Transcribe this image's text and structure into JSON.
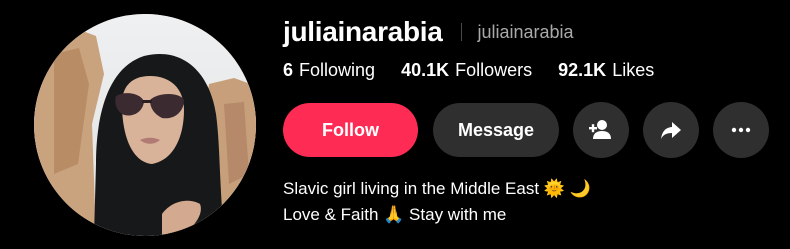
{
  "profile": {
    "username": "juliainarabia",
    "nickname": "juliainarabia",
    "stats": {
      "following_count": "6",
      "following_label": "Following",
      "followers_count": "40.1K",
      "followers_label": "Followers",
      "likes_count": "92.1K",
      "likes_label": "Likes"
    },
    "actions": {
      "follow_label": "Follow",
      "message_label": "Message",
      "add_friend_icon": "person-add-icon",
      "share_icon": "share-arrow-icon",
      "more_icon": "more-horizontal-icon"
    },
    "bio": {
      "line1": "Slavic girl living in the Middle East 🌞 🌙",
      "line2": "Love & Faith 🙏 Stay with me"
    },
    "avatar_icon": "profile-avatar-photo"
  },
  "colors": {
    "background": "#000000",
    "follow_button": "#fe2c55",
    "secondary_button": "#2f2f2f",
    "muted_text": "#a9a9a9"
  }
}
